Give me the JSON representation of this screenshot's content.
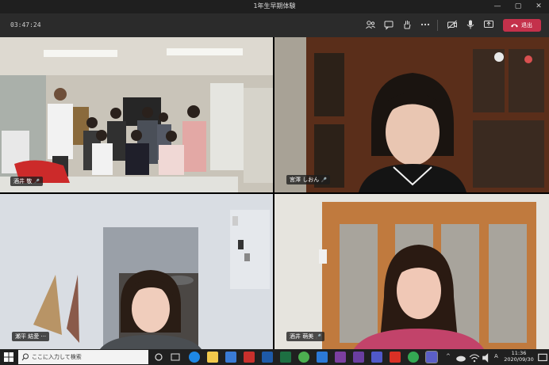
{
  "window": {
    "title": "1年生早期体験",
    "minimize": "—",
    "maximize": "▢",
    "close": "✕"
  },
  "meeting": {
    "timer": "03:47:24",
    "leave_label": "退出"
  },
  "participants": [
    {
      "name": "酒井 敬",
      "mic_glyph": "🎤"
    },
    {
      "name": "宮澤 しおん",
      "mic_glyph": "🎤"
    },
    {
      "name": "瀬平 結愛",
      "more_glyph": "···"
    },
    {
      "name": "酒井 萌美",
      "mic_glyph": "🎤"
    }
  ],
  "icons": {
    "toolbar": [
      "people-icon",
      "chat-icon",
      "raise-hand-icon",
      "more-icon",
      "camera-off-icon",
      "microphone-icon",
      "share-screen-icon"
    ],
    "taskbar": [
      "windows-start-icon",
      "search-icon",
      "task-view-icon",
      "edge-icon",
      "file-explorer-icon",
      "store-icon",
      "mail-icon",
      "word-icon",
      "powerpoint-icon",
      "excel-icon",
      "chrome-icon",
      "onenote-icon",
      "onenote-icon-2",
      "teams-icon",
      "acrobat-icon",
      "chrome-icon-2",
      "teams-active-icon"
    ]
  },
  "taskbar": {
    "search_placeholder": "ここに入力して検索",
    "tray_chevron": "^",
    "ime": "A",
    "time": "11:36",
    "date": "2020/09/30"
  },
  "colors": {
    "leave_button": "#c4314b",
    "toolbar_bg": "#2b2b2b",
    "titlebar_bg": "#1f1f1f",
    "taskbar_bg": "#202020"
  }
}
